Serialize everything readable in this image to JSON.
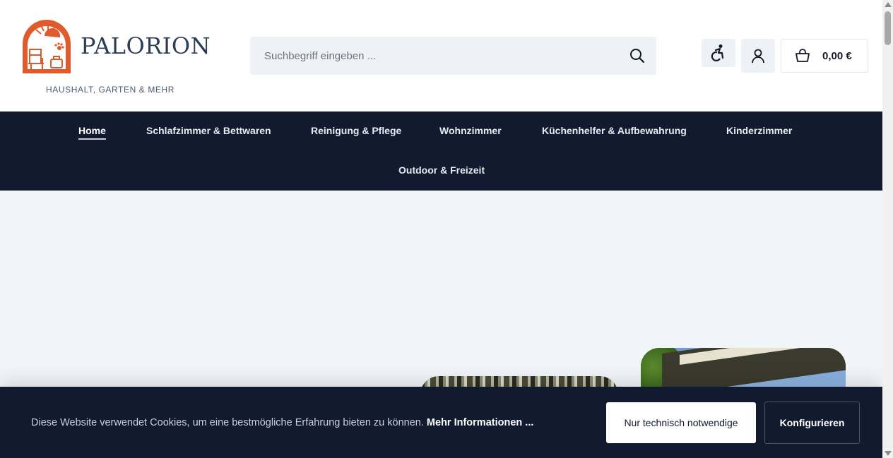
{
  "brand": {
    "name": "PALORION",
    "tagline": "HAUSHALT, GARTEN & MEHR",
    "color": "#e05a2b"
  },
  "search": {
    "placeholder": "Suchbegriff eingeben ...",
    "button_icon": "search-icon"
  },
  "header_actions": {
    "accessibility_icon": "wheelchair-icon",
    "account_icon": "user-icon",
    "cart_icon": "shopping-bag-icon",
    "cart_amount": "0,00 €"
  },
  "nav": {
    "items": [
      {
        "label": "Home",
        "active": true
      },
      {
        "label": "Schlafzimmer & Bettwaren"
      },
      {
        "label": "Reinigung & Pflege"
      },
      {
        "label": "Wohnzimmer"
      },
      {
        "label": "Küchenhelfer & Aufbewahrung"
      },
      {
        "label": "Kinderzimmer"
      },
      {
        "label": "Outdoor & Freizeit"
      }
    ]
  },
  "cookie": {
    "text": "Diese Website verwendet Cookies, um eine bestmögliche Erfahrung bieten zu können.",
    "more_link": "Mehr Informationen ...",
    "technical_button": "Nur technisch notwendige",
    "configure_button": "Konfigurieren"
  },
  "colors": {
    "nav_background": "#111a2e",
    "page_background": "#f1f4f9",
    "accent": "#e05a2b"
  }
}
